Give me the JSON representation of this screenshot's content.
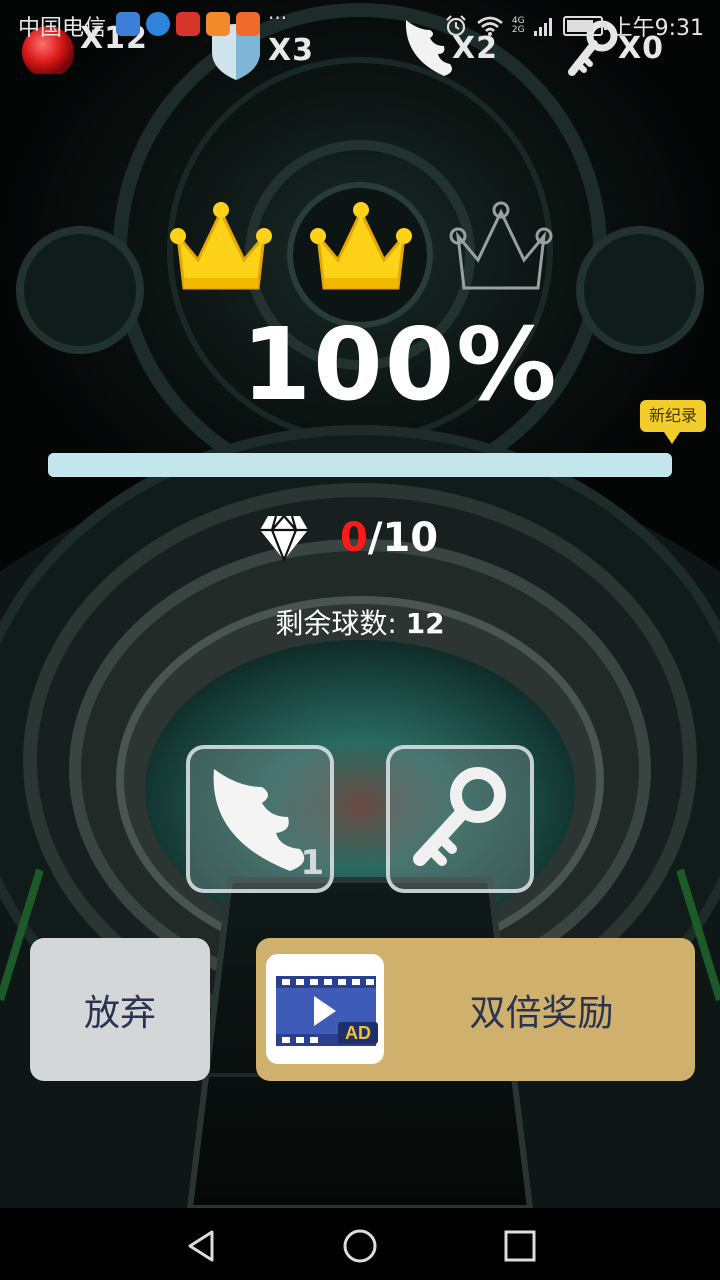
{
  "status_bar": {
    "carrier": "中国电信",
    "more": "···",
    "network": [
      "4G",
      "2G"
    ],
    "time": "上午9:31",
    "battery_level": 0.85,
    "app_icons": [
      {
        "name": "app-icon-blue-circle",
        "color": "#3d7fd8"
      },
      {
        "name": "app-icon-browser",
        "color": "#2f83d9"
      },
      {
        "name": "app-icon-news",
        "color": "#d9342b"
      },
      {
        "name": "app-icon-uc",
        "color": "#f08a2b"
      },
      {
        "name": "app-icon-video",
        "color": "#f06a2b"
      }
    ]
  },
  "counters": [
    {
      "name": "red-ball-counter",
      "icon": "red-ball-icon",
      "value": "X12"
    },
    {
      "name": "shield-counter",
      "icon": "shield-icon",
      "value": "X3"
    },
    {
      "name": "wing-counter",
      "icon": "wing-icon",
      "value": "X2"
    },
    {
      "name": "key-counter",
      "icon": "key-icon",
      "value": "X0"
    }
  ],
  "crowns": {
    "earned": 2,
    "total": 3,
    "earned_color": "#ffd21a",
    "empty_color": "#9aa0a0"
  },
  "result": {
    "percent": "100%",
    "progress": 1.0,
    "new_record_label": "新纪录"
  },
  "gems": {
    "collected": "0",
    "total": "/10"
  },
  "balls_left": {
    "label": "剩余球数: ",
    "value": "12"
  },
  "items": [
    {
      "name": "wing-item-button",
      "icon": "wing-icon",
      "count": "1"
    },
    {
      "name": "key-item-button",
      "icon": "key-icon",
      "count": ""
    }
  ],
  "buttons": {
    "give_up": "放弃",
    "double_reward": "双倍奖励",
    "ad_badge": "AD"
  },
  "colors": {
    "accent_gold": "#cfb06c",
    "gem_red": "#ff1a1a",
    "record_yellow": "#f2cd2b"
  }
}
